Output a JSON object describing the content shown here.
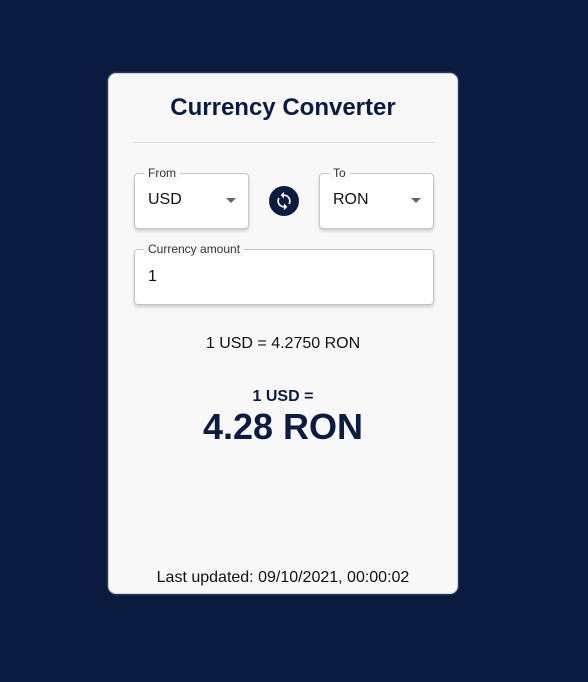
{
  "title": "Currency Converter",
  "from": {
    "label": "From",
    "value": "USD"
  },
  "to": {
    "label": "To",
    "value": "RON"
  },
  "amount": {
    "label": "Currency amount",
    "value": "1"
  },
  "rate_line": "1 USD = 4.2750 RON",
  "result": {
    "label": "1 USD =",
    "value": "4.28 RON"
  },
  "last_updated": "Last updated: 09/10/2021, 00:00:02",
  "icons": {
    "swap": "swap-icon",
    "dropdown": "chevron-down-icon"
  },
  "colors": {
    "background": "#0b1a3f",
    "card": "#f8f8f8",
    "accent": "#0c1b40"
  }
}
